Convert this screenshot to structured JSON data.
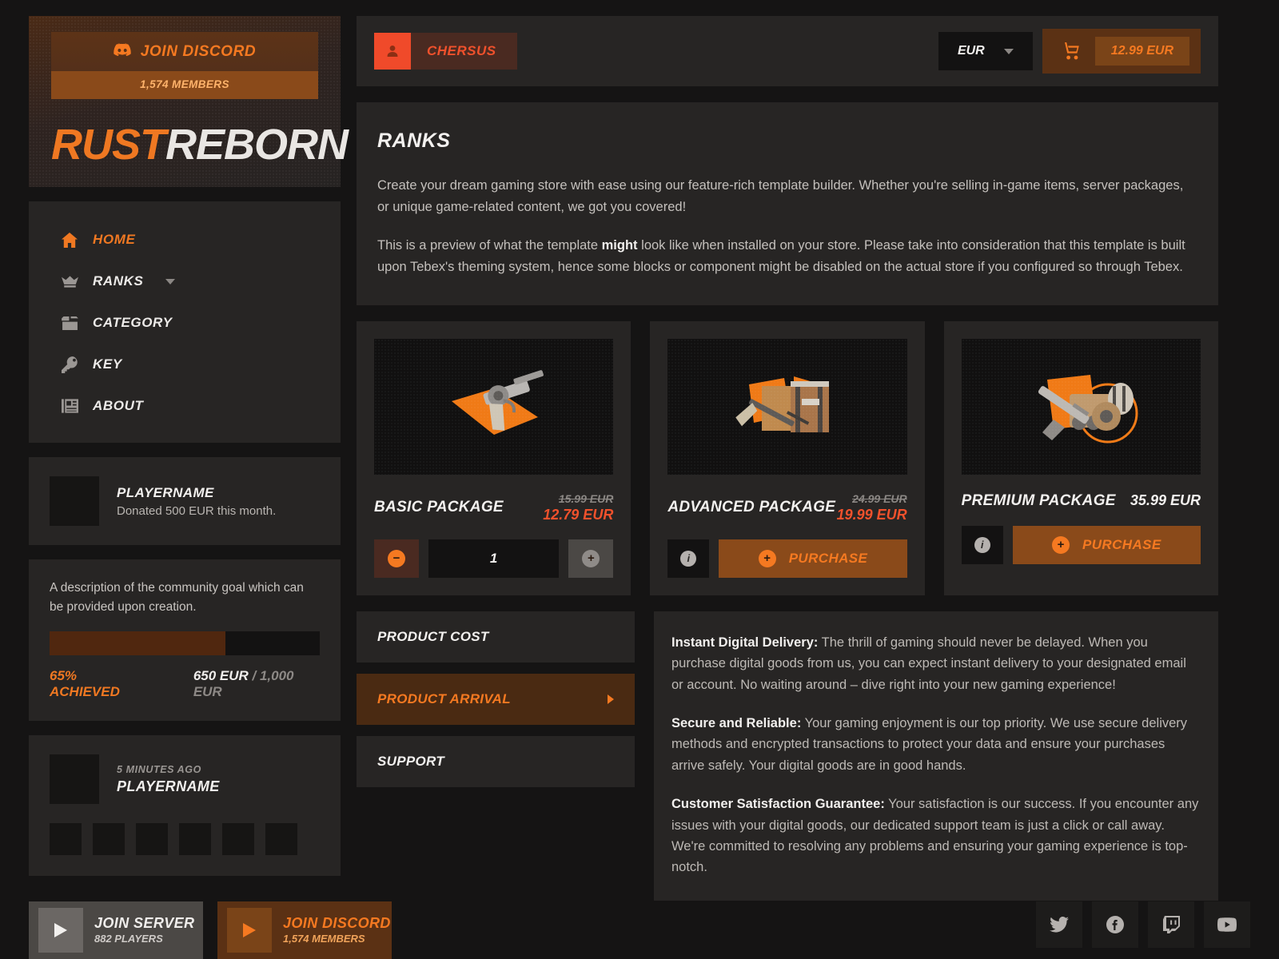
{
  "sidebar": {
    "discord": {
      "label": "JOIN DISCORD",
      "members": "1,574 MEMBERS",
      "icon": "discord-icon"
    },
    "logo": {
      "part1": "RUST",
      "part2": "REBORN"
    },
    "nav": [
      {
        "label": "HOME",
        "icon": "home-icon",
        "active": true
      },
      {
        "label": "RANKS",
        "icon": "crown-icon",
        "active": false,
        "dropdown": true
      },
      {
        "label": "CATEGORY",
        "icon": "box-icon",
        "active": false
      },
      {
        "label": "KEY",
        "icon": "key-icon",
        "active": false
      },
      {
        "label": "ABOUT",
        "icon": "news-icon",
        "active": false
      }
    ],
    "top_donor": {
      "name": "PLAYERNAME",
      "subtitle": "Donated 500 EUR this month."
    },
    "goal": {
      "description": "A description of the community goal which can be provided upon creation.",
      "percent_label": "65% ACHIEVED",
      "percent_value": 65,
      "current": "650 EUR",
      "separator": " / ",
      "target": "1,000 EUR"
    },
    "recent_purchase": {
      "time": "5 MINUTES AGO",
      "name": "PLAYERNAME",
      "thumb_count": 6
    }
  },
  "topbar": {
    "brand": "CHERSUS",
    "brand_icon": "user-avatar-icon",
    "currency": "EUR",
    "cart_icon": "cart-icon",
    "cart_total": "12.99 EUR"
  },
  "ranks": {
    "title": "RANKS",
    "paragraph1": "Create your dream gaming store with ease using our feature-rich template builder. Whether you're selling in-game items, server packages, or unique game-related content, we got you covered!",
    "paragraph2_a": "This is a preview of what the template ",
    "paragraph2_b": "might",
    "paragraph2_c": " look like when installed on your store. Please take into consideration that this template is built upon Tebex's theming system, hence some blocks or component might be disabled on the actual store if you configured so through Tebex."
  },
  "products": [
    {
      "name": "BASIC PACKAGE",
      "old_price": "15.99 EUR",
      "price": "12.79 EUR",
      "on_sale": true,
      "image": "revolver-item-icon",
      "control": "stepper",
      "quantity": "1"
    },
    {
      "name": "ADVANCED PACKAGE",
      "old_price": "24.99 EUR",
      "price": "19.99 EUR",
      "on_sale": true,
      "image": "crate-rifle-item-icon",
      "control": "purchase",
      "purchase_label": "PURCHASE"
    },
    {
      "name": "PREMIUM PACKAGE",
      "old_price": "",
      "price": "35.99 EUR",
      "on_sale": false,
      "image": "weapon-mod-item-icon",
      "control": "purchase",
      "purchase_label": "PURCHASE"
    }
  ],
  "accordion": [
    {
      "label": "PRODUCT COST",
      "active": false
    },
    {
      "label": "PRODUCT ARRIVAL",
      "active": true
    },
    {
      "label": "SUPPORT",
      "active": false
    }
  ],
  "info_panel": [
    {
      "heading": "Instant Digital Delivery:",
      "body": " The thrill of gaming should never be delayed. When you purchase digital goods from us, you can expect instant delivery to your designated email or account. No waiting around – dive right into your new gaming experience!"
    },
    {
      "heading": "Secure and Reliable:",
      "body": " Your gaming enjoyment is our top priority. We use secure delivery methods and encrypted transactions to protect your data and ensure your purchases arrive safely. Your digital goods are in good hands."
    },
    {
      "heading": "Customer Satisfaction Guarantee:",
      "body": " Your satisfaction is our success. If you encounter any issues with your digital goods, our dedicated support team is just a click or call away. We're committed to resolving any problems and ensuring your gaming experience is top-notch."
    }
  ],
  "footer": {
    "server_button": {
      "title": "JOIN SERVER",
      "subtitle": "882 PLAYERS",
      "icon": "play-icon"
    },
    "discord_button": {
      "title": "JOIN DISCORD",
      "subtitle": "1,574 MEMBERS",
      "icon": "play-icon"
    },
    "socials": [
      "twitter-icon",
      "facebook-icon",
      "twitch-icon",
      "youtube-icon"
    ]
  },
  "colors": {
    "accent": "#f57921",
    "accent_red": "#f0512c",
    "panel": "#272524",
    "bg": "#151414"
  }
}
